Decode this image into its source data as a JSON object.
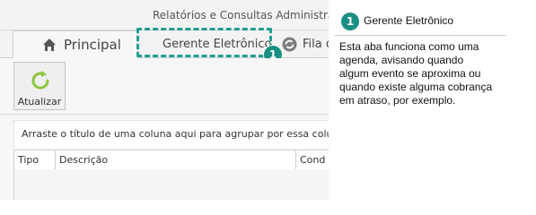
{
  "window": {
    "title": "Relatórios e Consultas Administração"
  },
  "tabs": [
    {
      "label": "Principal",
      "icon": "home-icon"
    },
    {
      "label": "Gerente Eletrônico",
      "icon": "monitor-icon"
    },
    {
      "label": "Fila d",
      "icon": "refresh-circle-icon"
    }
  ],
  "callout": {
    "number": "1"
  },
  "toolbar": {
    "update_label": "Atualizar",
    "update_icon": "refresh-icon"
  },
  "grid": {
    "group_hint": "Arraste o título de uma coluna aqui para agrupar por essa coluna",
    "columns": [
      "Tipo",
      "Descrição",
      "Cond"
    ]
  },
  "annotation": {
    "number": "1",
    "title": "Gerente Eletrônico",
    "body": "Esta aba funciona como uma agenda, avisando quando algum evento se aproxima ou quando existe alguma cobrança em atraso, por exemplo."
  },
  "colors": {
    "accent": "#1a8f84",
    "highlight_border": "#1f9f92",
    "refresh_green": "#8cc63f"
  }
}
